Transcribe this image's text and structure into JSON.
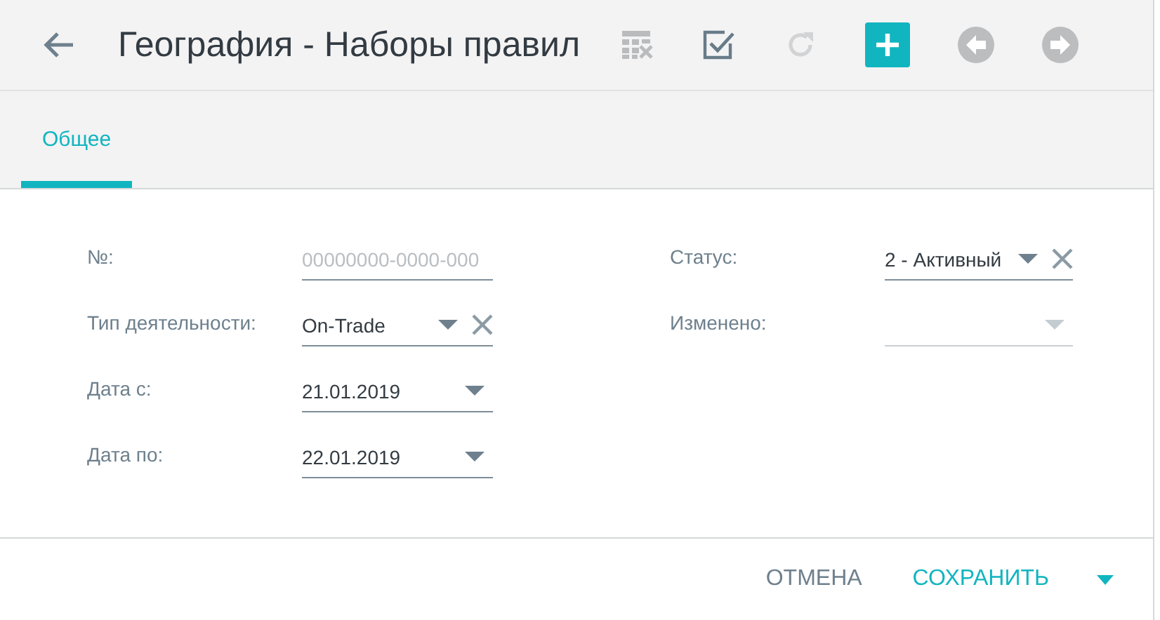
{
  "header": {
    "title": "География - Наборы правил",
    "toolbar": [
      {
        "kind": "clear-table",
        "disabled": true
      },
      {
        "kind": "check",
        "disabled": false
      },
      {
        "kind": "refresh",
        "disabled": true
      },
      {
        "kind": "add",
        "disabled": false
      },
      {
        "kind": "prev",
        "disabled": false
      },
      {
        "kind": "next",
        "disabled": false
      }
    ]
  },
  "tabs": [
    {
      "label": "Общее",
      "selected": true
    }
  ],
  "form": {
    "left": [
      {
        "label": "№:",
        "kind": "text",
        "placeholder": "00000000-0000-000"
      },
      {
        "label": "Тип деятельности:",
        "kind": "select",
        "value": "On-Trade",
        "clearable": true
      },
      {
        "label": "Дата с:",
        "kind": "select",
        "value": "21.01.2019",
        "clearable": false
      },
      {
        "label": "Дата по:",
        "kind": "select",
        "value": "22.01.2019",
        "clearable": false
      }
    ],
    "right": [
      {
        "label": "Статус:",
        "kind": "select",
        "value": "2 - Активный",
        "clearable": true
      },
      {
        "label": "Изменено:",
        "kind": "select",
        "clearable": false,
        "disabled": true
      }
    ]
  },
  "footer": {
    "cancel": "ОТМЕНА",
    "save": "СОХРАНИТЬ"
  }
}
